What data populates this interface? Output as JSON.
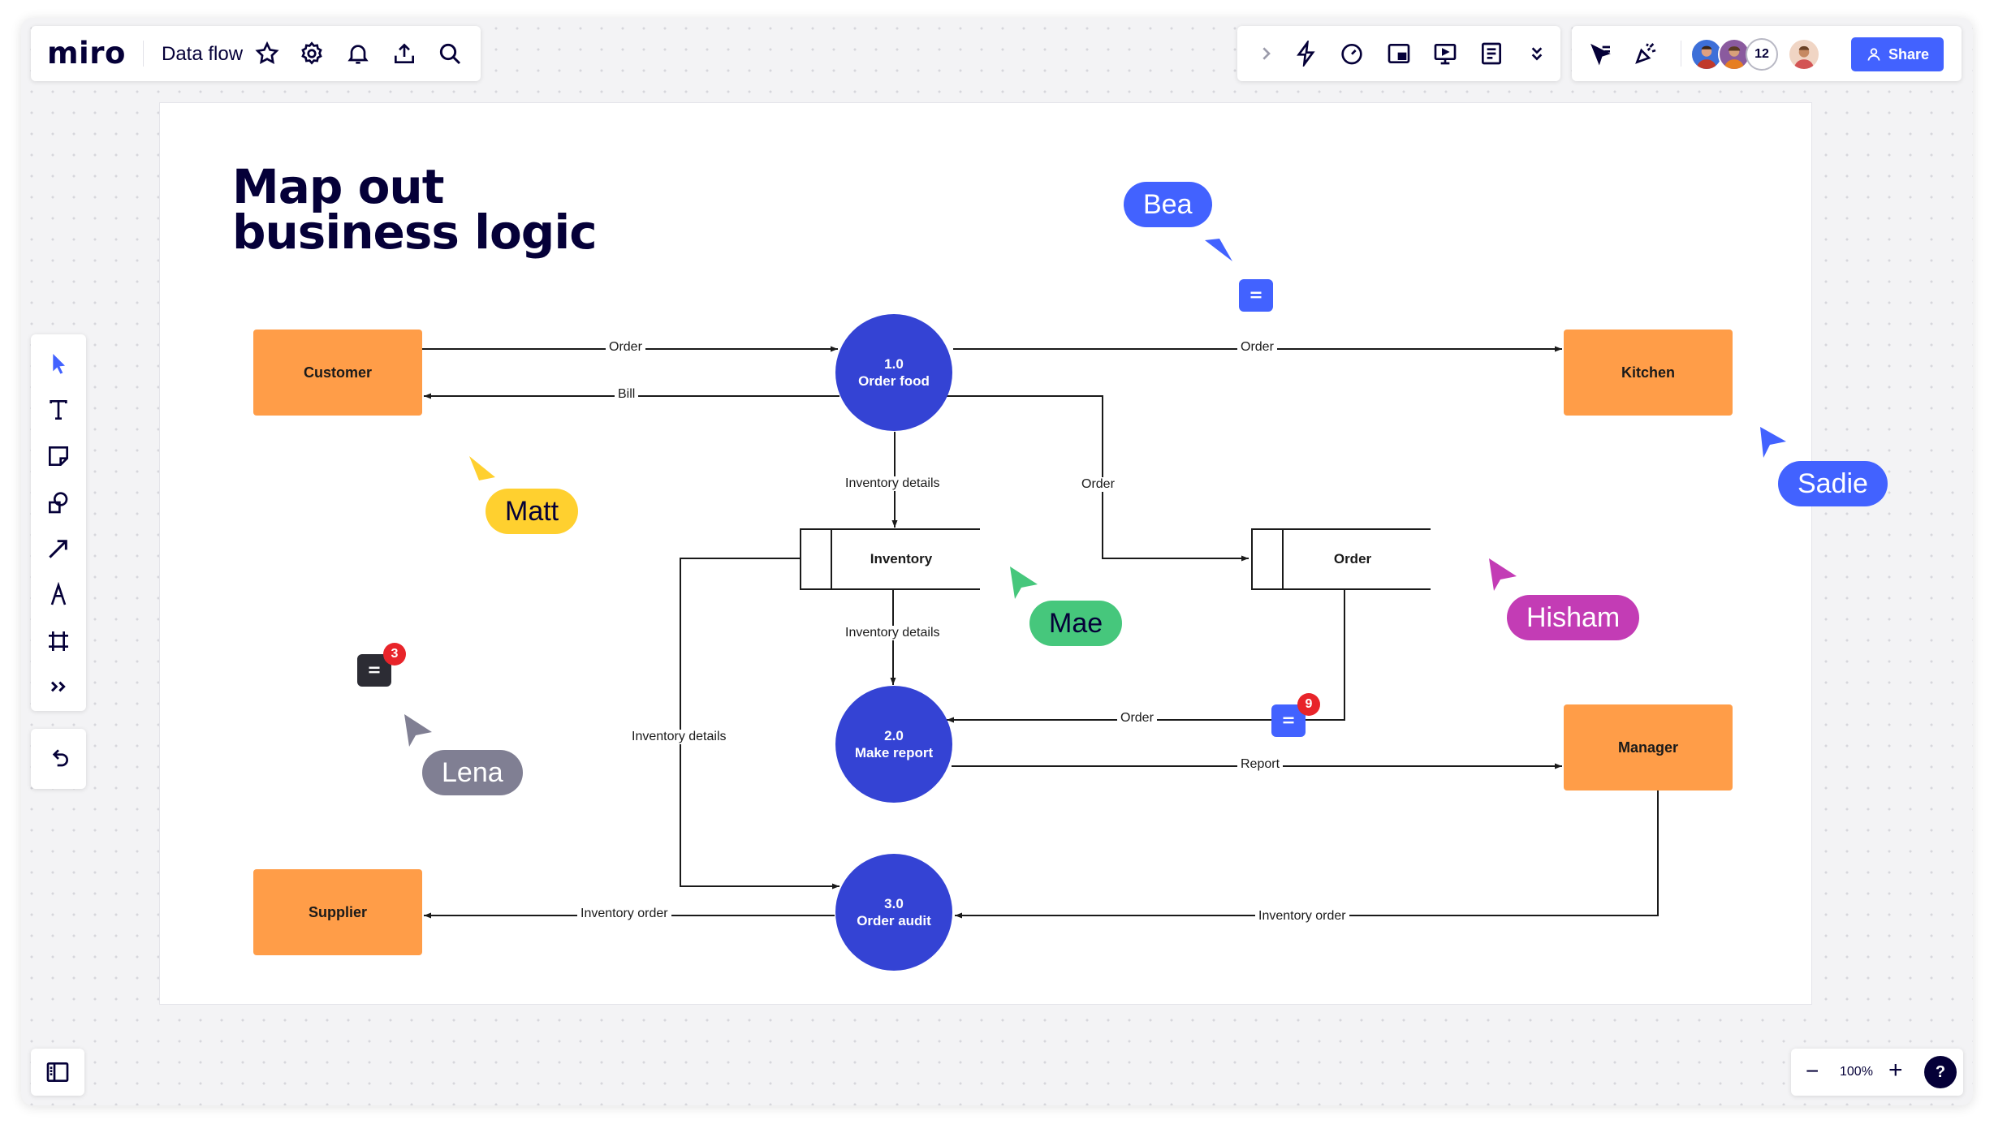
{
  "app": {
    "logo": "miro",
    "board_name": "Data flow"
  },
  "toolbar_top_left": {
    "icons": [
      "star-icon",
      "settings-icon",
      "bell-icon",
      "upload-icon",
      "search-icon"
    ]
  },
  "toolbar_top_mid": {
    "icons": [
      "chevron-right-icon",
      "lightning-icon",
      "timer-icon",
      "frame-icon",
      "presentation-icon",
      "notes-icon",
      "chevron-double-down-icon"
    ]
  },
  "toolbar_top_right": {
    "icons": [
      "cursor-select-icon",
      "celebrate-icon"
    ],
    "collaborator_count": "12",
    "share_label": "Share"
  },
  "left_tools": [
    "cursor-icon",
    "text-icon",
    "sticky-note-icon",
    "shapes-icon",
    "arrow-line-icon",
    "pen-icon",
    "frame-crop-icon",
    "more-icon"
  ],
  "zoom": {
    "level": "100%",
    "minus": "−",
    "plus": "+",
    "help": "?"
  },
  "board": {
    "title_line1": "Map out",
    "title_line2": "business logic",
    "entities": {
      "customer": "Customer",
      "kitchen": "Kitchen",
      "manager": "Manager",
      "supplier": "Supplier"
    },
    "processes": {
      "p1": {
        "num": "1.0",
        "name": "Order food"
      },
      "p2": {
        "num": "2.0",
        "name": "Make report"
      },
      "p3": {
        "num": "3.0",
        "name": "Order audit"
      }
    },
    "stores": {
      "inventory": "Inventory",
      "order": "Order"
    },
    "flows": {
      "cust_order": "Order",
      "bill": "Bill",
      "kitchen_order": "Order",
      "order_to_store": "Order",
      "inv_details_1": "Inventory details",
      "inv_details_2": "Inventory details",
      "inv_details_3": "Inventory details",
      "order_to_report": "Order",
      "report": "Report",
      "inv_order_supplier": "Inventory order",
      "inv_order_manager": "Inventory order"
    },
    "cursors": {
      "bea": "Bea",
      "matt": "Matt",
      "sadie": "Sadie",
      "mae": "Mae",
      "hisham": "Hisham",
      "lena": "Lena"
    },
    "comments": {
      "lena_badge": "3",
      "report_badge": "9"
    },
    "colors": {
      "entity": "#ff9d48",
      "process": "#3443d4",
      "accent": "#4262ff",
      "bea": "#4262ff",
      "matt": "#ffd02f",
      "sadie": "#4262ff",
      "mae": "#46c77c",
      "hisham": "#c33cb5",
      "lena": "#807f93"
    }
  }
}
